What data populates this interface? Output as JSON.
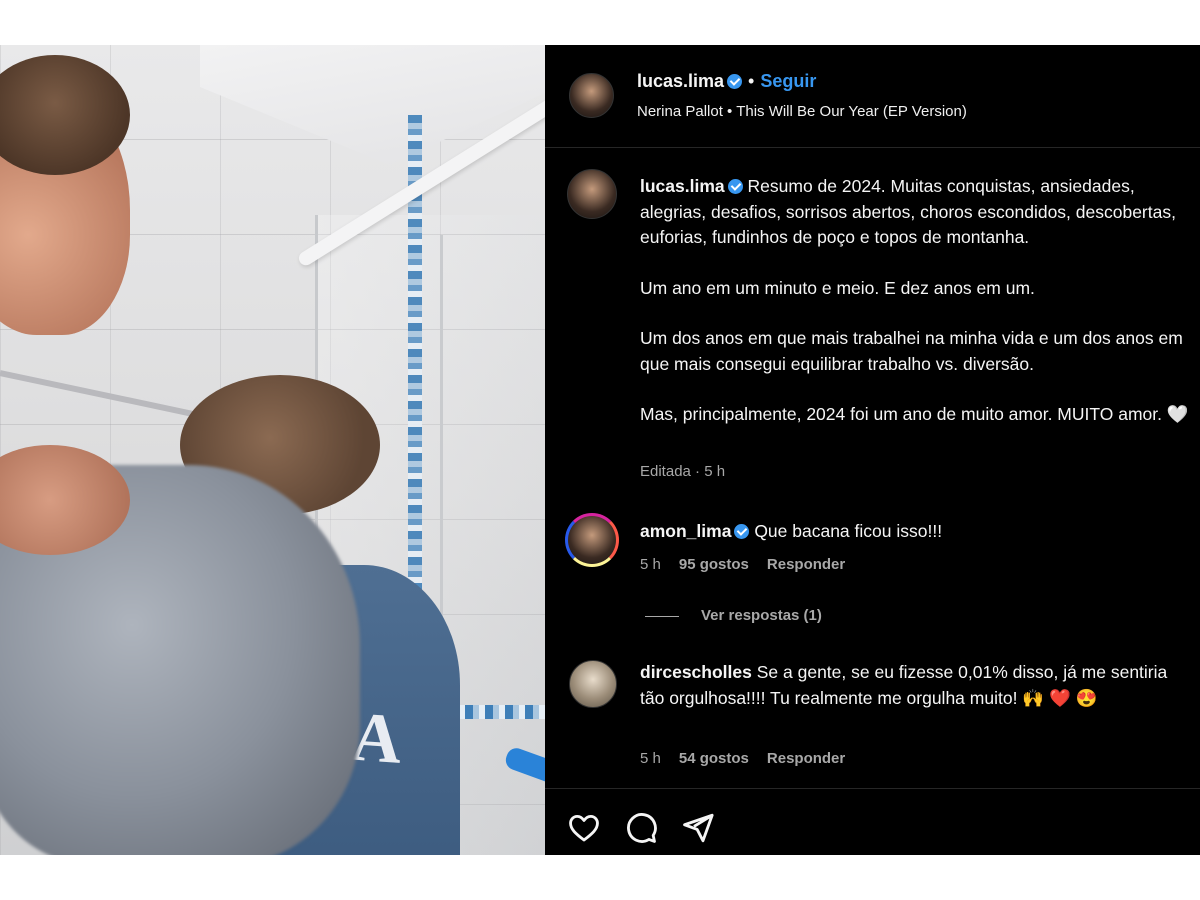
{
  "post": {
    "username": "lucas.lima",
    "follow_label": "Seguir",
    "separator": "•",
    "audio": "Nerina Pallot • This Will Be Our Year (EP Version)"
  },
  "media": {
    "shirt_text": "IANA"
  },
  "caption": {
    "username": "lucas.lima",
    "paragraphs": [
      "Resumo de 2024. Muitas conquistas, ansiedades, alegrias, desafios, sorrisos abertos, choros escondidos, descobertas, euforias, fundinhos de poço e topos de montanha.",
      "Um ano em um minuto e meio. E dez anos em um.",
      "Um dos anos em que mais trabalhei na minha vida e um dos anos em que mais consegui equilibrar trabalho vs. diversão.",
      "Mas, principalmente, 2024 foi um ano de muito amor. MUITO amor. 🤍"
    ],
    "meta": "Editada · 5 h"
  },
  "comments": [
    {
      "username": "amon_lima",
      "text": "Que bacana ficou isso!!!",
      "time": "5 h",
      "likes": "95 gostos",
      "reply": "Responder"
    },
    {
      "username": "dircescholles",
      "text": "Se a gente, se eu fizesse 0,01% disso, já me sentiria tão orgulhosa!!!! Tu realmente me orgulha muito! 🙌 ❤️ 😍",
      "time": "5 h",
      "likes": "54 gostos",
      "reply": "Responder"
    }
  ],
  "view_replies": "Ver respostas (1)",
  "icons": {
    "like": "heart-icon",
    "comment": "comment-icon",
    "share": "send-icon"
  },
  "colors": {
    "accent": "#3897f0",
    "background": "#000000",
    "muted": "#a8a8a8"
  }
}
